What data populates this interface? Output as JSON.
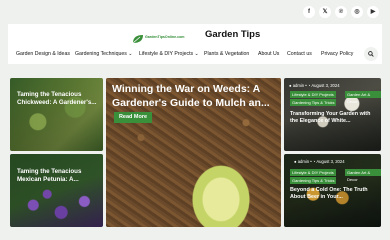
{
  "social": [
    {
      "icon": "facebook-icon",
      "glyph": "f"
    },
    {
      "icon": "x-icon",
      "glyph": "𝕏"
    },
    {
      "icon": "pinterest-icon",
      "glyph": "℗"
    },
    {
      "icon": "instagram-icon",
      "glyph": "◎"
    },
    {
      "icon": "youtube-icon",
      "glyph": "▶"
    }
  ],
  "header": {
    "logo_text": "GardenTipsOnline.com",
    "site_title": "Garden Tips"
  },
  "nav": {
    "items": [
      "Garden Design & Ideas",
      "Gardening Techniques ⌄",
      "Lifestyle & DIY Projects ⌄",
      "Plants & Vegetation",
      "About Us",
      "Contact us",
      "Privacy Policy"
    ]
  },
  "cards": {
    "chickweed": {
      "title": "Taming the Tenacious Chickweed: A Gardener's..."
    },
    "petunia": {
      "title": "Taming the Tenacious Mexican Petunia: A..."
    },
    "weeds": {
      "title": "Winning the War on Weeds: A Gardener's Guide to Mulch an...",
      "button": "Read More"
    },
    "elegance": {
      "author": "admin",
      "date": "August 3, 2024",
      "tags": [
        "Lifestyle & DIY Projects",
        "Garden Art & Decor",
        "Gardening Tips & Tricks"
      ],
      "title": "Transforming Your Garden with the Elegance of White..."
    },
    "beer": {
      "author": "admin",
      "date": "August 3, 2024",
      "tags": [
        "Lifestyle & DIY Projects",
        "Garden Art & Decor",
        "Gardening Tips & Tricks"
      ],
      "title": "Beyond a Cold One: The Truth About Beer in Your..."
    }
  },
  "colors": {
    "accent": "#3a8f3a"
  }
}
